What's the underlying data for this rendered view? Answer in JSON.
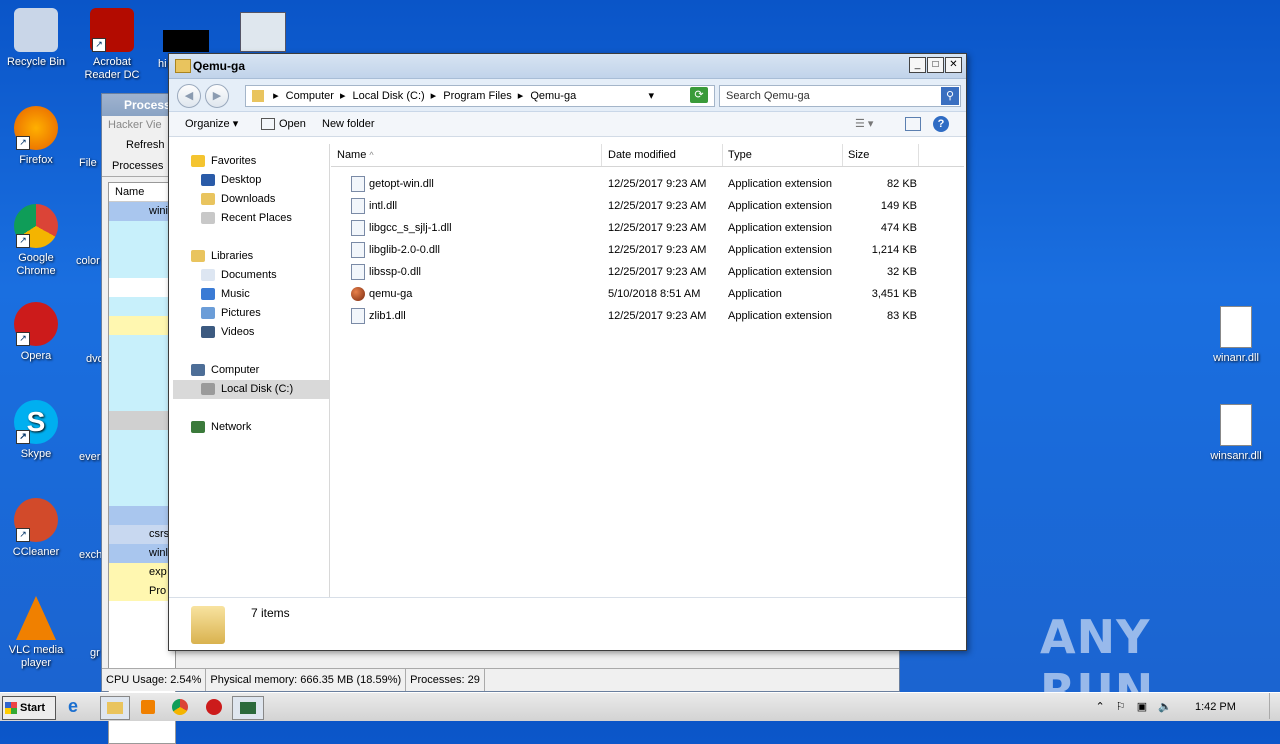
{
  "desktop": {
    "icons": [
      {
        "label": "Recycle Bin",
        "icon": "recycle-bin-icon",
        "color": "#c9d6e8"
      },
      {
        "label": "Acrobat Reader DC",
        "icon": "acrobat-icon",
        "color": "#b30b00"
      },
      {
        "label": "Firefox",
        "icon": "firefox-icon",
        "color": "#e66000"
      },
      {
        "label": "Google Chrome",
        "icon": "chrome-icon",
        "color": "#3b8e3b"
      },
      {
        "label": "Opera",
        "icon": "opera-icon",
        "color": "#cc1b1b"
      },
      {
        "label": "Skype",
        "icon": "skype-icon",
        "color": "#00aff0"
      },
      {
        "label": "CCleaner",
        "icon": "ccleaner-icon",
        "color": "#d24a2a"
      },
      {
        "label": "VLC media player",
        "icon": "vlc-icon",
        "color": "#f08000"
      },
      {
        "label": "winanr.dll",
        "icon": "dll-icon",
        "color": "#ffffff"
      },
      {
        "label": "winsanr.dll",
        "icon": "dll-icon",
        "color": "#ffffff"
      }
    ],
    "partial_labels": [
      "hi",
      "File",
      "color",
      "dvd",
      "ever",
      "exch",
      "gr"
    ]
  },
  "process_window": {
    "title": "Process",
    "menu": "Hacker  Vie",
    "refresh": "Refresh",
    "tab": "Processes",
    "col_name": "Name",
    "rows": [
      "wini",
      "",
      "",
      "",
      "",
      "",
      "",
      "",
      "",
      "",
      "",
      "",
      "",
      "",
      "",
      "",
      "",
      "csrs",
      "winl",
      "exp",
      "Pro"
    ],
    "status": {
      "cpu": "CPU Usage: 2.54%",
      "memory": "Physical memory: 666.35 MB (18.59%)",
      "processes": "Processes: 29"
    }
  },
  "explorer": {
    "title": "Qemu-ga",
    "breadcrumbs": [
      "Computer",
      "Local Disk (C:)",
      "Program Files",
      "Qemu-ga"
    ],
    "search_placeholder": "Search Qemu-ga",
    "commands": {
      "organize": "Organize",
      "open": "Open",
      "new_folder": "New folder"
    },
    "nav": {
      "favorites": "Favorites",
      "desktop": "Desktop",
      "downloads": "Downloads",
      "recent": "Recent Places",
      "libraries": "Libraries",
      "documents": "Documents",
      "music": "Music",
      "pictures": "Pictures",
      "videos": "Videos",
      "computer": "Computer",
      "local_disk": "Local Disk (C:)",
      "network": "Network"
    },
    "columns": {
      "name": "Name",
      "date": "Date modified",
      "type": "Type",
      "size": "Size"
    },
    "files": [
      {
        "name": "getopt-win.dll",
        "date": "12/25/2017 9:23 AM",
        "type": "Application extension",
        "size": "82 KB",
        "kind": "dll"
      },
      {
        "name": "intl.dll",
        "date": "12/25/2017 9:23 AM",
        "type": "Application extension",
        "size": "149 KB",
        "kind": "dll"
      },
      {
        "name": "libgcc_s_sjlj-1.dll",
        "date": "12/25/2017 9:23 AM",
        "type": "Application extension",
        "size": "474 KB",
        "kind": "dll"
      },
      {
        "name": "libglib-2.0-0.dll",
        "date": "12/25/2017 9:23 AM",
        "type": "Application extension",
        "size": "1,214 KB",
        "kind": "dll"
      },
      {
        "name": "libssp-0.dll",
        "date": "12/25/2017 9:23 AM",
        "type": "Application extension",
        "size": "32 KB",
        "kind": "dll"
      },
      {
        "name": "qemu-ga",
        "date": "5/10/2018 8:51 AM",
        "type": "Application",
        "size": "3,451 KB",
        "kind": "app"
      },
      {
        "name": "zlib1.dll",
        "date": "12/25/2017 9:23 AM",
        "type": "Application extension",
        "size": "83 KB",
        "kind": "dll"
      }
    ],
    "item_count": "7 items"
  },
  "taskbar": {
    "start": "Start",
    "clock": "1:42 PM"
  },
  "watermark": "ANY RUN"
}
